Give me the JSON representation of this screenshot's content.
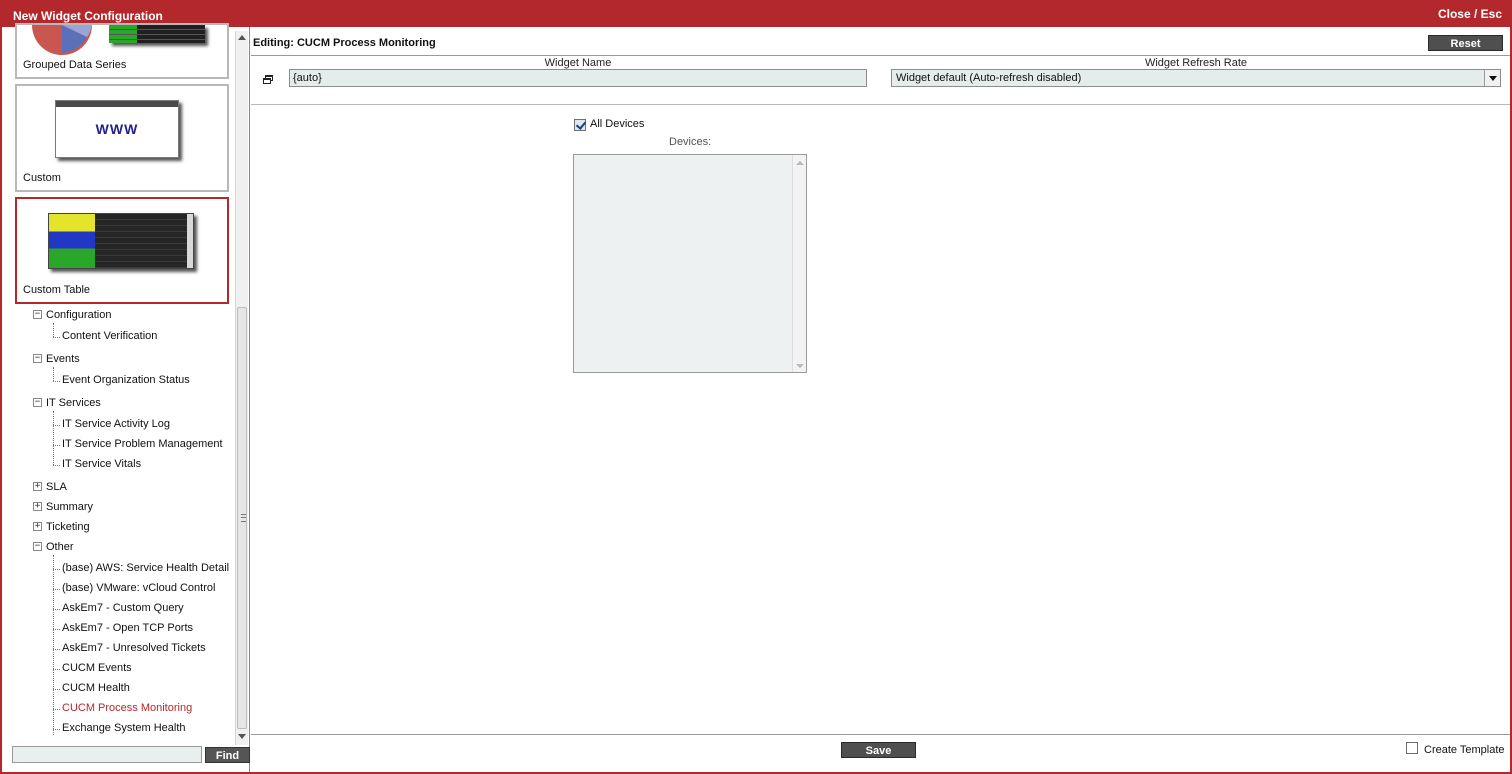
{
  "window": {
    "title": "New Widget Configuration",
    "close_label": "Close / Esc",
    "accent_color": "#b3282d"
  },
  "gallery": [
    {
      "label": "Grouped Data Series",
      "selected": false
    },
    {
      "label": "Custom",
      "selected": false,
      "thumbnail_text": "WWW"
    },
    {
      "label": "Custom Table",
      "selected": true
    }
  ],
  "tree": {
    "groups": [
      {
        "label": "Configuration",
        "expanded": true,
        "children": [
          "Content Verification"
        ]
      },
      {
        "label": "Events",
        "expanded": true,
        "children": [
          "Event Organization Status"
        ]
      },
      {
        "label": "IT Services",
        "expanded": true,
        "children": [
          "IT Service Activity Log",
          "IT Service Problem Management",
          "IT Service Vitals"
        ]
      },
      {
        "label": "SLA",
        "expanded": false,
        "children": []
      },
      {
        "label": "Summary",
        "expanded": false,
        "children": []
      },
      {
        "label": "Ticketing",
        "expanded": false,
        "children": []
      },
      {
        "label": "Other",
        "expanded": true,
        "children": [
          "(base) AWS: Service Health Detail",
          "(base) VMware: vCloud Control",
          "AskEm7 - Custom Query",
          "AskEm7 - Open TCP Ports",
          "AskEm7 - Unresolved Tickets",
          "CUCM Events",
          "CUCM Health",
          "CUCM Process Monitoring",
          "Exchange System Health"
        ]
      }
    ],
    "active_item": "CUCM Process Monitoring"
  },
  "find": {
    "input_value": "",
    "button_label": "Find"
  },
  "editor": {
    "heading": "Editing: CUCM Process Monitoring",
    "reset_label": "Reset",
    "widget_name_label": "Widget Name",
    "widget_name_value": "{auto}",
    "refresh_label": "Widget Refresh Rate",
    "refresh_value": "Widget default (Auto-refresh disabled)",
    "all_devices_label": "All Devices",
    "all_devices_checked": true,
    "devices_label": "Devices:",
    "save_label": "Save",
    "create_template_label": "Create Template",
    "create_template_checked": false
  }
}
